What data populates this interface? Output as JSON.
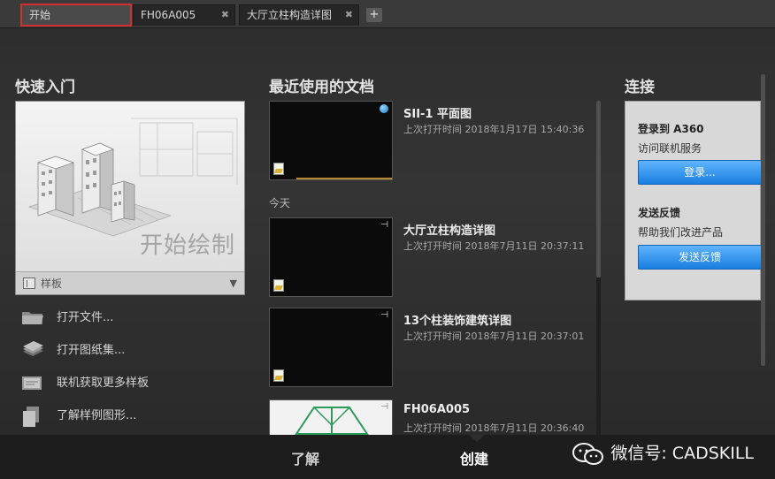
{
  "tabs": [
    {
      "label": "开始",
      "active": true
    },
    {
      "label": "FH06A005",
      "active": false
    },
    {
      "label": "大厅立柱构造详图",
      "active": false
    }
  ],
  "tab_close_glyph": "✖",
  "tab_add_glyph": "+",
  "quick_start": {
    "title": "快速入门",
    "start_drawing": "开始绘制",
    "template_label": "样板",
    "actions": [
      {
        "label": "打开文件...",
        "icon": "folder-icon"
      },
      {
        "label": "打开图纸集...",
        "icon": "sheet-set-icon"
      },
      {
        "label": "联机获取更多样板",
        "icon": "online-templates-icon"
      },
      {
        "label": "了解样例图形...",
        "icon": "sample-drawings-icon"
      }
    ]
  },
  "recent": {
    "title": "最近使用的文档",
    "today_label": "今天",
    "documents": [
      {
        "title": "SII-1 平面图",
        "time": "上次打开时间 2018年1月17日 15:40:36"
      },
      {
        "title": "大厅立柱构造详图",
        "time": "上次打开时间 2018年7月11日 20:37:11"
      },
      {
        "title": "13个柱装饰建筑详图",
        "time": "上次打开时间 2018年7月11日 20:37:01"
      },
      {
        "title": "FH06A005",
        "time": "上次打开时间 2018年7月11日 20:36:40"
      }
    ]
  },
  "connect": {
    "title": "连接",
    "a360_title": "登录到 A360",
    "a360_sub": "访问联机服务",
    "login_button": "登录...",
    "feedback_title": "发送反馈",
    "feedback_sub": "帮助我们改进产品",
    "feedback_button": "发送反馈"
  },
  "bottom_tabs": [
    {
      "label": "了解",
      "active": false
    },
    {
      "label": "创建",
      "active": true
    }
  ],
  "watermark": "微信号: CADSKILL",
  "colors": {
    "accent_blue": "#1a7fe0",
    "highlight_red": "#d0302e",
    "background": "#2b2b2b"
  }
}
